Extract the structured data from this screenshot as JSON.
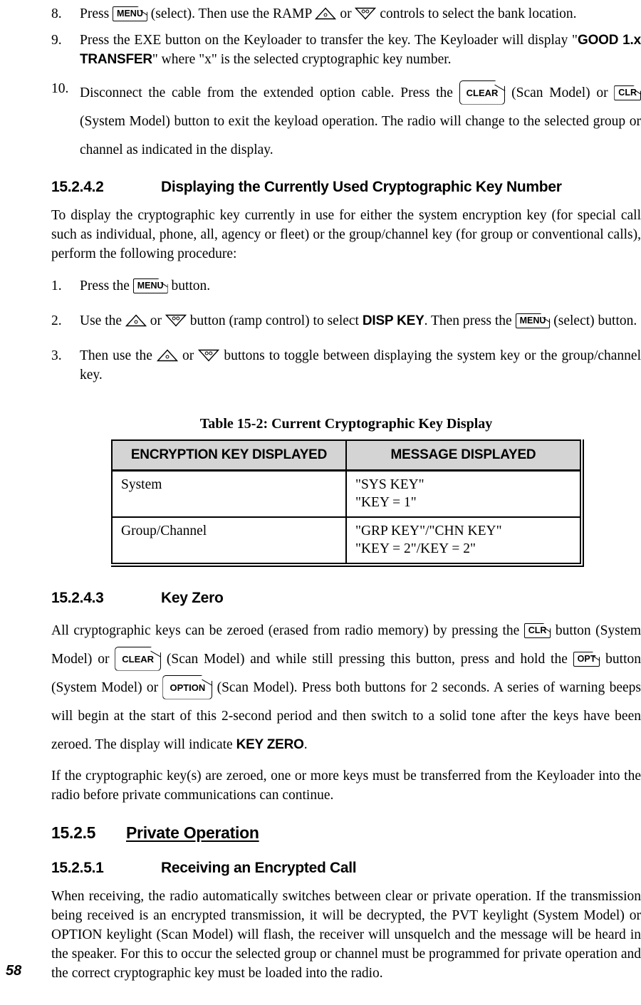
{
  "document": {
    "page_number": "58",
    "table_header_bg": "#d4d4d4",
    "text_color": "#000000",
    "page_bg": "#ffffff"
  },
  "steps": [
    {
      "number": "8.",
      "parts": [
        {
          "t": "text",
          "v": "Press "
        },
        {
          "t": "btn-small",
          "v": "MENU"
        },
        {
          "t": "text",
          "v": " (select). Then use the RAMP "
        },
        {
          "t": "ramp-up",
          "v": "ramp-up-icon"
        },
        {
          "t": "text",
          "v": " or "
        },
        {
          "t": "ramp-down",
          "v": "ramp-down-icon"
        },
        {
          "t": "text",
          "v": " controls to select the bank location."
        }
      ]
    },
    {
      "number": "9.",
      "parts": [
        {
          "t": "text",
          "v": "Press the EXE button on the Keyloader to transfer the key. The Keyloader will display \""
        },
        {
          "t": "bold-sans",
          "v": "GOOD 1.x TRANSFER"
        },
        {
          "t": "text",
          "v": "\" where \"x\" is the selected cryptographic key number."
        }
      ]
    },
    {
      "number": "10.",
      "parts": [
        {
          "t": "text",
          "v": "Disconnect the cable from the extended option cable. Press the "
        },
        {
          "t": "btn-big",
          "v": "CLEAR"
        },
        {
          "t": "text",
          "v": " (Scan Model) or "
        },
        {
          "t": "btn-small",
          "v": "CLR"
        },
        {
          "t": "text",
          "v": " (System Model) button to exit the keyload operation. The radio will change to the selected group or channel as indicated in the display."
        }
      ]
    }
  ],
  "section_15242": {
    "number": "15.2.4.2",
    "title": "Displaying the Currently Used Cryptographic Key Number",
    "intro": "To display the cryptographic key currently in use for either the system encryption key (for special call such as individual, phone, all, agency or fleet) or the group/channel key (for group or conventional calls), perform the following procedure:",
    "steps": [
      {
        "number": "1.",
        "parts": [
          {
            "t": "text",
            "v": "Press the "
          },
          {
            "t": "btn-small",
            "v": "MENU"
          },
          {
            "t": "text",
            "v": " button."
          }
        ]
      },
      {
        "number": "2.",
        "parts": [
          {
            "t": "text",
            "v": "Use the "
          },
          {
            "t": "ramp-up",
            "v": "ramp-up-icon"
          },
          {
            "t": "text",
            "v": " or "
          },
          {
            "t": "ramp-down",
            "v": "ramp-down-icon"
          },
          {
            "t": "text",
            "v": " button (ramp control) to select "
          },
          {
            "t": "bold-sans",
            "v": "DISP KEY"
          },
          {
            "t": "text",
            "v": ". Then press the "
          },
          {
            "t": "btn-small",
            "v": "MENU"
          },
          {
            "t": "text",
            "v": " (select) button."
          }
        ]
      },
      {
        "number": "3.",
        "parts": [
          {
            "t": "text",
            "v": "Then use the "
          },
          {
            "t": "ramp-up",
            "v": "ramp-up-icon"
          },
          {
            "t": "text",
            "v": " or "
          },
          {
            "t": "ramp-down",
            "v": "ramp-down-icon"
          },
          {
            "t": "text",
            "v": " buttons to toggle between displaying the system key or the group/channel key."
          }
        ]
      }
    ]
  },
  "table": {
    "caption": "Table 15-2:  Current Cryptographic Key Display",
    "columns": [
      "ENCRYPTION KEY DISPLAYED",
      "MESSAGE DISPLAYED"
    ],
    "rows": [
      {
        "key": "System",
        "message_line1": "\"SYS KEY\"",
        "message_line2": "\"KEY = 1\""
      },
      {
        "key": "Group/Channel",
        "message_line1": "\"GRP KEY\"/\"CHN KEY\"",
        "message_line2": "\"KEY = 2\"/KEY = 2\""
      }
    ]
  },
  "section_15243": {
    "number": "15.2.4.3",
    "title": "Key Zero",
    "para1_parts": [
      {
        "t": "text",
        "v": "All cryptographic keys can be zeroed (erased from radio memory) by pressing the "
      },
      {
        "t": "btn-small",
        "v": "CLR"
      },
      {
        "t": "text",
        "v": " button (System Model) or "
      },
      {
        "t": "btn-big",
        "v": "CLEAR"
      },
      {
        "t": "text",
        "v": " (Scan Model) and while still pressing this button, press and hold the "
      },
      {
        "t": "btn-small",
        "v": "OPT"
      },
      {
        "t": "text",
        "v": " button (System Model) or "
      },
      {
        "t": "btn-big",
        "v": "OPTION"
      },
      {
        "t": "text",
        "v": " (Scan Model). Press both buttons for 2 seconds. A series of warning beeps will begin at the start of this 2-second period and then switch to a solid tone after the keys have been zeroed. The display will indicate "
      },
      {
        "t": "bold-sans",
        "v": "KEY ZERO"
      },
      {
        "t": "text",
        "v": "."
      }
    ],
    "para2": "If the cryptographic key(s) are zeroed, one or more keys must be transferred from the Keyloader into the radio before private communications can continue."
  },
  "section_1525": {
    "number": "15.2.5",
    "title": "Private Operation"
  },
  "section_15251": {
    "number": "15.2.5.1",
    "title": "Receiving an Encrypted Call",
    "para1": "When receiving, the radio automatically switches between clear or private operation. If the transmission being received is an encrypted transmission, it will be decrypted, the PVT keylight (System Model) or OPTION keylight (Scan Model) will flash, the receiver will unsquelch and the message will be heard in the speaker. For this to occur the selected group or channel must be programmed for private operation and the correct cryptographic key must be loaded into the radio."
  }
}
